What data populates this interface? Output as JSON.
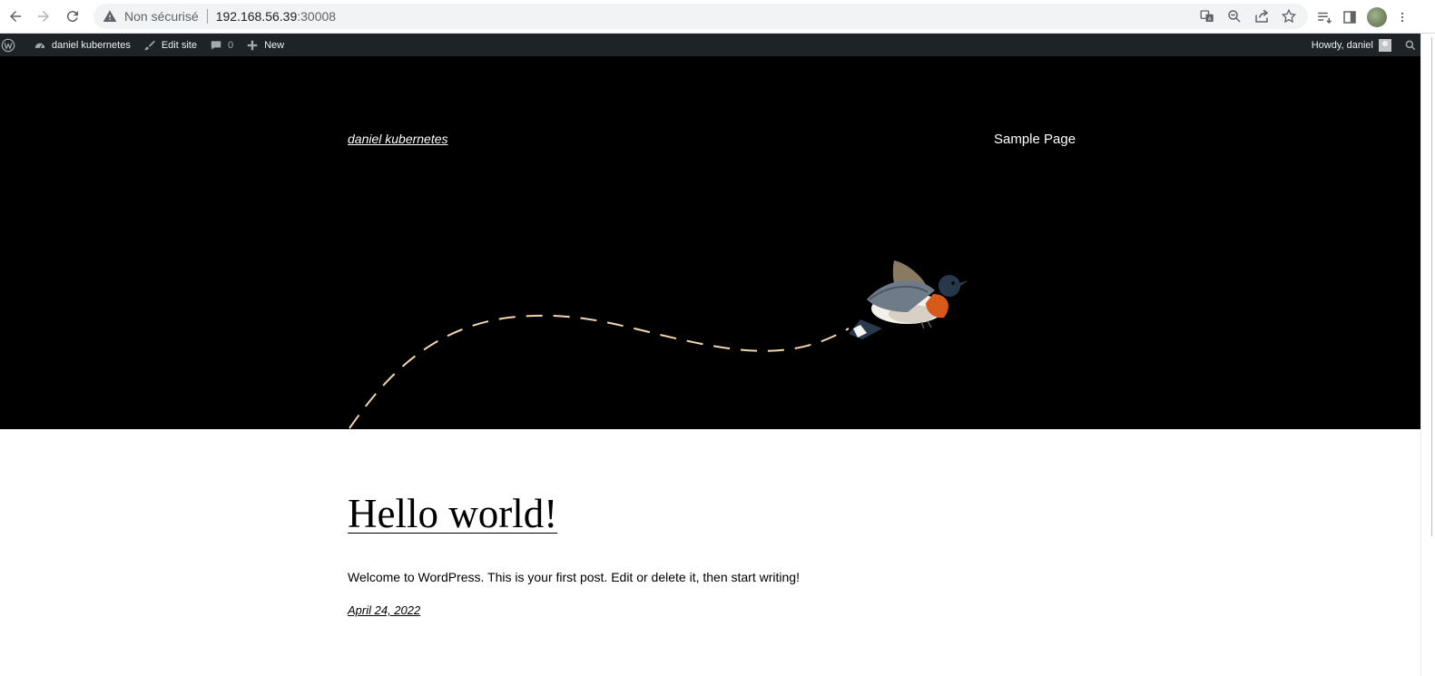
{
  "browser": {
    "security_label": "Non sécurisé",
    "url_host": "192.168.56.39",
    "url_port": ":30008",
    "icons": [
      "back-icon",
      "forward-icon",
      "reload-icon",
      "warning-icon",
      "translate-icon",
      "zoom-icon",
      "share-icon",
      "bookmark-star-icon",
      "reading-list-icon",
      "side-panel-icon",
      "profile-avatar",
      "more-menu-icon"
    ]
  },
  "adminbar": {
    "site_name": "daniel kubernetes",
    "edit_site": "Edit site",
    "comments_count": "0",
    "new_label": "New",
    "howdy": "Howdy, daniel"
  },
  "header": {
    "site_title": "daniel kubernetes",
    "nav_items": [
      "Sample Page"
    ],
    "background": "#000000",
    "path_color": "#f3d5b0"
  },
  "post": {
    "title": "Hello world!",
    "excerpt": "Welcome to WordPress. This is your first post. Edit or delete it, then start writing!",
    "date": "April 24, 2022"
  }
}
